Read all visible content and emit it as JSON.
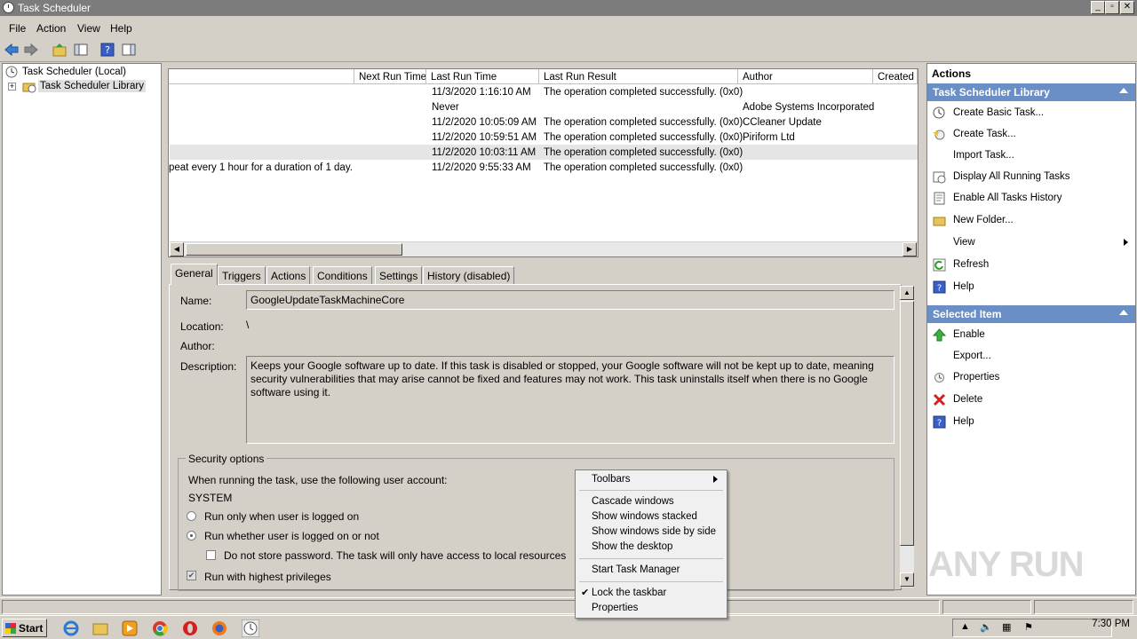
{
  "window": {
    "title": "Task Scheduler"
  },
  "menubar": {
    "items": [
      "File",
      "Action",
      "View",
      "Help"
    ]
  },
  "tree": {
    "root": "Task Scheduler (Local)",
    "library": "Task Scheduler Library",
    "expander": "+"
  },
  "task_list": {
    "columns": [
      "Next Run Time",
      "Last Run Time",
      "Last Run Result",
      "Author",
      "Created"
    ],
    "rows": [
      {
        "trigger": "",
        "last_run": "11/3/2020 1:16:10 AM",
        "result": "The operation completed successfully. (0x0)",
        "author": ""
      },
      {
        "trigger": "",
        "last_run": "Never",
        "result": "",
        "author": "Adobe Systems Incorporated"
      },
      {
        "trigger": "",
        "last_run": "11/2/2020 10:05:09 AM",
        "result": "The operation completed successfully. (0x0)",
        "author": "CCleaner Update"
      },
      {
        "trigger": "",
        "last_run": "11/2/2020 10:59:51 AM",
        "result": "The operation completed successfully. (0x0)",
        "author": "Piriform Ltd"
      },
      {
        "trigger": "",
        "last_run": "11/2/2020 10:03:11 AM",
        "result": "The operation completed successfully. (0x0)",
        "author": ""
      },
      {
        "trigger": "peat every 1 hour for a duration of 1 day.",
        "last_run": "11/2/2020 9:55:33 AM",
        "result": "The operation completed successfully. (0x0)",
        "author": ""
      }
    ],
    "selected_row": 4
  },
  "detail": {
    "tabs": [
      "General",
      "Triggers",
      "Actions",
      "Conditions",
      "Settings",
      "History (disabled)"
    ],
    "active_tab": "General",
    "name_label": "Name:",
    "name_value": "GoogleUpdateTaskMachineCore",
    "location_label": "Location:",
    "location_value": "\\",
    "author_label": "Author:",
    "description_label": "Description:",
    "description_value": "Keeps your Google software up to date. If this task is disabled or stopped, your Google software will not be kept up to date, meaning security vulnerabilities that may arise cannot be fixed and features may not work. This task uninstalls itself when there is no Google software using it.",
    "security": {
      "title": "Security options",
      "account_prompt": "When running the task, use the following user account:",
      "account": "SYSTEM",
      "radio_logged_on": "Run only when user is logged on",
      "radio_whether": "Run whether user is logged on or not",
      "no_store_password": "Do not store password.  The task will only have access to local resources",
      "highest_privileges": "Run with highest privileges"
    }
  },
  "actions_pane": {
    "header": "Actions",
    "library_section": "Task Scheduler Library",
    "library_items": [
      "Create Basic Task...",
      "Create Task...",
      "Import Task...",
      "Display All Running Tasks",
      "Enable All Tasks History",
      "New Folder...",
      "View",
      "Refresh",
      "Help"
    ],
    "selected_section": "Selected Item",
    "selected_items": [
      "Enable",
      "Export...",
      "Properties",
      "Delete",
      "Help"
    ]
  },
  "context_menu": {
    "items": [
      "Toolbars",
      "Cascade windows",
      "Show windows stacked",
      "Show windows side by side",
      "Show the desktop",
      "Start Task Manager",
      "Lock the taskbar",
      "Properties"
    ]
  },
  "taskbar": {
    "start_label": "Start",
    "clock": "7:30 PM"
  },
  "watermark": {
    "text": "ANY RUN"
  },
  "colors": {
    "section_header": "#6a8fc6",
    "title_bar": "#7c7c7c",
    "selected_row": "#e5e5e5"
  }
}
